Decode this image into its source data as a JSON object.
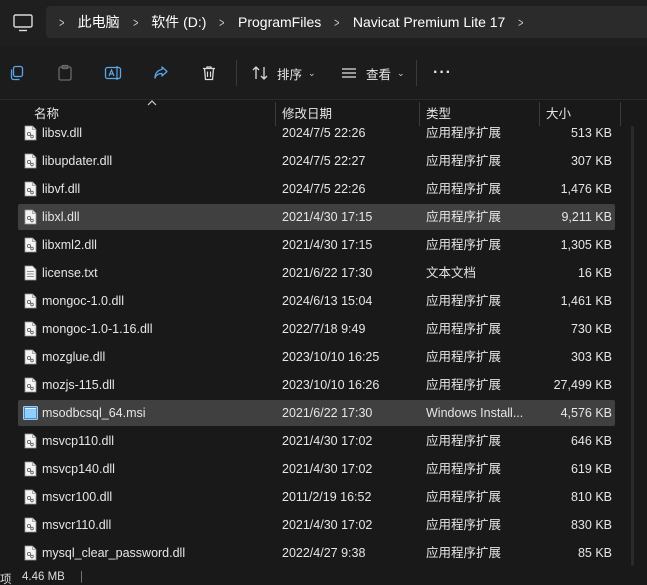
{
  "address": {
    "breadcrumbs": [
      "此电脑",
      "软件 (D:)",
      "ProgramFiles",
      "Navicat Premium Lite 17"
    ]
  },
  "toolbar": {
    "sort_label": "排序",
    "view_label": "查看",
    "more_label": "···"
  },
  "columns": {
    "name": "名称",
    "date": "修改日期",
    "type": "类型",
    "size": "大小"
  },
  "files": [
    {
      "name": "libsv.dll",
      "date": "2024/7/5 22:26",
      "type": "应用程序扩展",
      "size": "513 KB",
      "icon": "dll-file-icon",
      "selected": false
    },
    {
      "name": "libupdater.dll",
      "date": "2024/7/5 22:27",
      "type": "应用程序扩展",
      "size": "307 KB",
      "icon": "dll-file-icon",
      "selected": false
    },
    {
      "name": "libvf.dll",
      "date": "2024/7/5 22:26",
      "type": "应用程序扩展",
      "size": "1,476 KB",
      "icon": "dll-file-icon",
      "selected": false
    },
    {
      "name": "libxl.dll",
      "date": "2021/4/30 17:15",
      "type": "应用程序扩展",
      "size": "9,211 KB",
      "icon": "dll-file-icon",
      "selected": true
    },
    {
      "name": "libxml2.dll",
      "date": "2021/4/30 17:15",
      "type": "应用程序扩展",
      "size": "1,305 KB",
      "icon": "dll-file-icon",
      "selected": false
    },
    {
      "name": "license.txt",
      "date": "2021/6/22 17:30",
      "type": "文本文档",
      "size": "16 KB",
      "icon": "text-file-icon",
      "selected": false
    },
    {
      "name": "mongoc-1.0.dll",
      "date": "2024/6/13 15:04",
      "type": "应用程序扩展",
      "size": "1,461 KB",
      "icon": "dll-file-icon",
      "selected": false
    },
    {
      "name": "mongoc-1.0-1.16.dll",
      "date": "2022/7/18 9:49",
      "type": "应用程序扩展",
      "size": "730 KB",
      "icon": "dll-file-icon",
      "selected": false
    },
    {
      "name": "mozglue.dll",
      "date": "2023/10/10 16:25",
      "type": "应用程序扩展",
      "size": "303 KB",
      "icon": "dll-file-icon",
      "selected": false
    },
    {
      "name": "mozjs-115.dll",
      "date": "2023/10/10 16:26",
      "type": "应用程序扩展",
      "size": "27,499 KB",
      "icon": "dll-file-icon",
      "selected": false
    },
    {
      "name": "msodbcsql_64.msi",
      "date": "2021/6/22 17:30",
      "type": "Windows Install...",
      "size": "4,576 KB",
      "icon": "msi-installer-icon",
      "selected": true
    },
    {
      "name": "msvcp110.dll",
      "date": "2021/4/30 17:02",
      "type": "应用程序扩展",
      "size": "646 KB",
      "icon": "dll-file-icon",
      "selected": false
    },
    {
      "name": "msvcp140.dll",
      "date": "2021/4/30 17:02",
      "type": "应用程序扩展",
      "size": "619 KB",
      "icon": "dll-file-icon",
      "selected": false
    },
    {
      "name": "msvcr100.dll",
      "date": "2011/2/19 16:52",
      "type": "应用程序扩展",
      "size": "810 KB",
      "icon": "dll-file-icon",
      "selected": false
    },
    {
      "name": "msvcr110.dll",
      "date": "2021/4/30 17:02",
      "type": "应用程序扩展",
      "size": "830 KB",
      "icon": "dll-file-icon",
      "selected": false
    },
    {
      "name": "mysql_clear_password.dll",
      "date": "2022/4/27 9:38",
      "type": "应用程序扩展",
      "size": "85 KB",
      "icon": "dll-file-icon",
      "selected": false
    }
  ],
  "status": {
    "left": "项",
    "selection_size": "4.46 MB"
  },
  "colors": {
    "background": "#191919",
    "selection": "#404040",
    "address_bar": "#2b2b2b"
  }
}
